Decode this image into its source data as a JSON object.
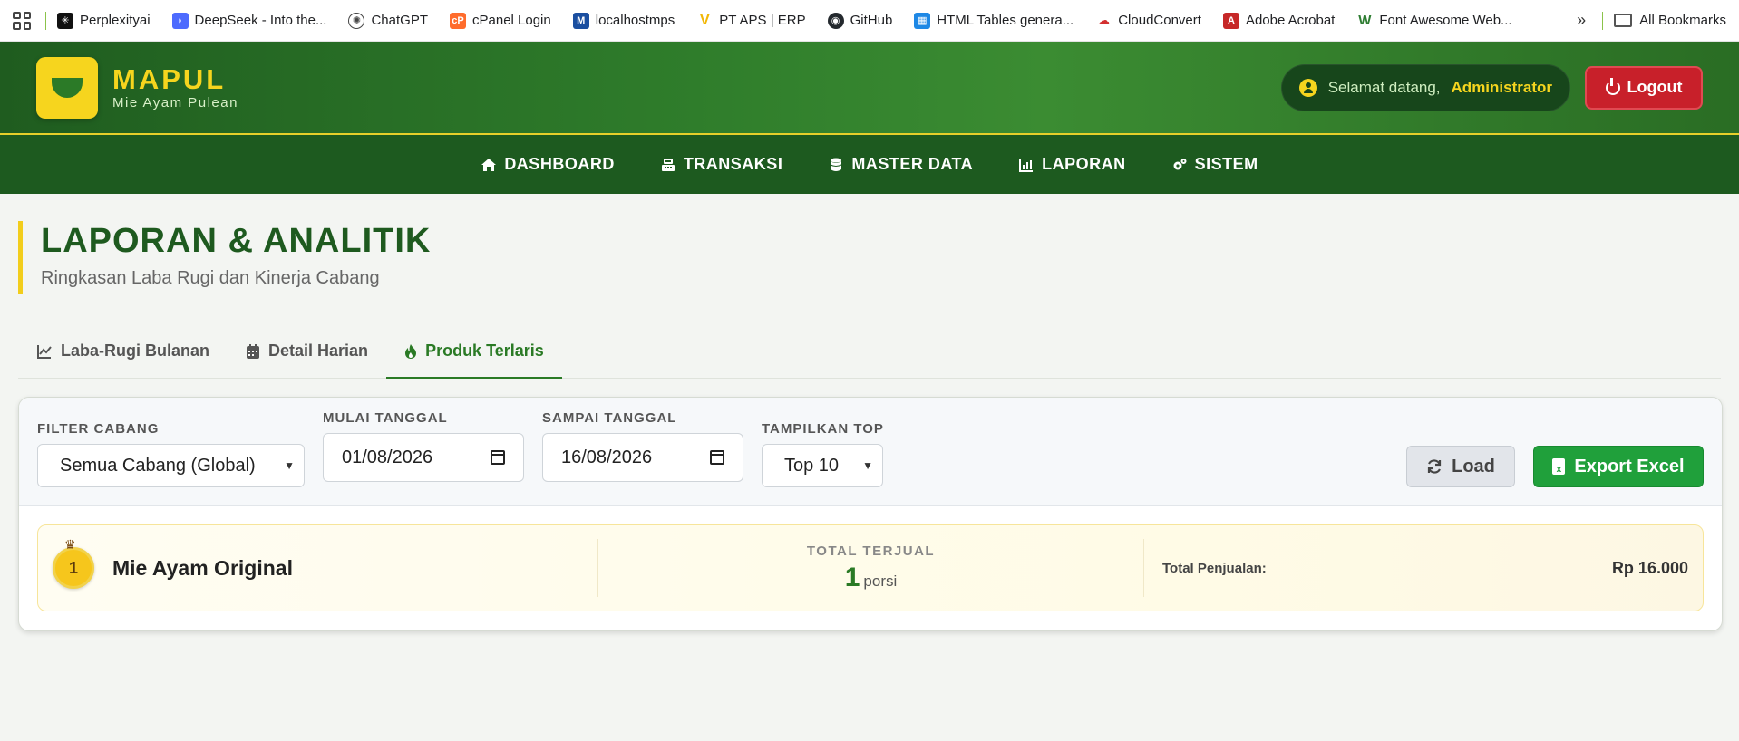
{
  "bookmarks": {
    "items": [
      {
        "label": "Perplexityai",
        "icon": "perplexity-icon",
        "color": "#111111"
      },
      {
        "label": "DeepSeek - Into the...",
        "icon": "deepseek-icon",
        "color": "#4d6bfe"
      },
      {
        "label": "ChatGPT",
        "icon": "chatgpt-icon",
        "color": "#444444"
      },
      {
        "label": "cPanel Login",
        "icon": "cpanel-icon",
        "color": "#ff6c2c"
      },
      {
        "label": "localhostmps",
        "icon": "mps-icon",
        "color": "#1b4fa0"
      },
      {
        "label": "PT APS | ERP",
        "icon": "aps-icon",
        "color": "#f2b705"
      },
      {
        "label": "GitHub",
        "icon": "github-icon",
        "color": "#24292e"
      },
      {
        "label": "HTML Tables genera...",
        "icon": "table-icon",
        "color": "#1e88e5"
      },
      {
        "label": "CloudConvert",
        "icon": "cloudconvert-icon",
        "color": "#d32f2f"
      },
      {
        "label": "Adobe Acrobat",
        "icon": "acrobat-icon",
        "color": "#c62828"
      },
      {
        "label": "Font Awesome Web...",
        "icon": "fontawesome-icon",
        "color": "#2e7d32"
      }
    ],
    "more": "»",
    "all_label": "All Bookmarks"
  },
  "header": {
    "brand_name": "MAPUL",
    "brand_sub": "Mie Ayam Pulean",
    "welcome": "Selamat datang,",
    "user": "Administrator",
    "logout": "Logout"
  },
  "nav": {
    "items": [
      {
        "label": "DASHBOARD",
        "icon": "home-icon"
      },
      {
        "label": "TRANSAKSI",
        "icon": "cash-register-icon"
      },
      {
        "label": "MASTER DATA",
        "icon": "database-icon"
      },
      {
        "label": "LAPORAN",
        "icon": "chart-icon"
      },
      {
        "label": "SISTEM",
        "icon": "gears-icon"
      }
    ]
  },
  "page": {
    "title": "LAPORAN & ANALITIK",
    "subtitle": "Ringkasan Laba Rugi dan Kinerja Cabang"
  },
  "tabs": [
    {
      "label": "Laba-Rugi Bulanan",
      "icon": "line-chart-icon",
      "active": false
    },
    {
      "label": "Detail Harian",
      "icon": "calendar-icon",
      "active": false
    },
    {
      "label": "Produk Terlaris",
      "icon": "fire-icon",
      "active": true
    }
  ],
  "filters": {
    "cabang_label": "FILTER CABANG",
    "cabang_value": "Semua Cabang (Global)",
    "mulai_label": "MULAI TANGGAL",
    "mulai_value": "01/08/2026",
    "sampai_label": "SAMPAI TANGGAL",
    "sampai_value": "16/08/2026",
    "top_label": "TAMPILKAN TOP",
    "top_value": "Top 10",
    "load_label": "Load",
    "export_label": "Export Excel"
  },
  "products": [
    {
      "rank": "1",
      "name": "Mie Ayam Original",
      "sold_label": "TOTAL TERJUAL",
      "sold_value": "1",
      "sold_unit": "porsi",
      "sales_label": "Total Penjualan:",
      "sales_value": "Rp 16.000"
    }
  ],
  "colors": {
    "brand_green": "#1e5a1f",
    "brand_yellow": "#f6d51e",
    "logout_red": "#c8202a",
    "excel_green": "#20a03b"
  }
}
